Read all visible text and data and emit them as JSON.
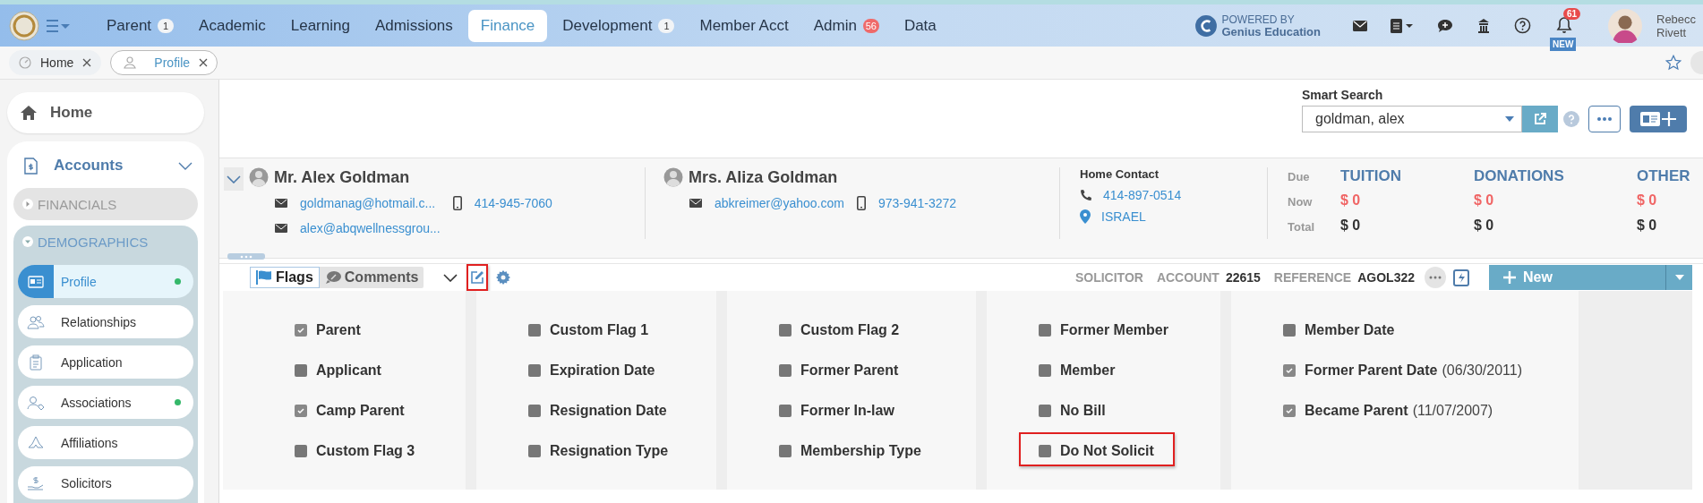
{
  "top_nav": {
    "items": [
      {
        "label": "Parent",
        "badge": "1",
        "badge_alert": false,
        "selected": false
      },
      {
        "label": "Academic",
        "selected": false
      },
      {
        "label": "Learning",
        "selected": false
      },
      {
        "label": "Admissions",
        "selected": false
      },
      {
        "label": "Finance",
        "selected": true
      },
      {
        "label": "Development",
        "badge": "1",
        "badge_alert": false,
        "selected": false
      },
      {
        "label": "Member Acct",
        "selected": false
      },
      {
        "label": "Admin",
        "badge": "56",
        "badge_alert": true,
        "selected": false
      },
      {
        "label": "Data",
        "selected": false
      }
    ],
    "powered_by": [
      "POWERED BY",
      "Genius Education"
    ],
    "notifications": "61",
    "new_tag": "NEW",
    "user": [
      "Rebecc",
      "Rivett"
    ]
  },
  "open_tabs": [
    {
      "label": "Home",
      "selected": false
    },
    {
      "label": "Profile",
      "selected": true
    }
  ],
  "sidebar": {
    "home": "Home",
    "accounts": "Accounts",
    "sections": [
      {
        "label": "FINANCIALS",
        "expanded": false
      },
      {
        "label": "DEMOGRAPHICS",
        "expanded": true,
        "items": [
          {
            "label": "Profile",
            "selected": true,
            "dot": true
          },
          {
            "label": "Relationships",
            "selected": false,
            "dot": false
          },
          {
            "label": "Application",
            "selected": false,
            "dot": false
          },
          {
            "label": "Associations",
            "selected": false,
            "dot": true
          },
          {
            "label": "Affiliations",
            "selected": false,
            "dot": false
          },
          {
            "label": "Solicitors",
            "selected": false,
            "dot": false
          }
        ]
      }
    ]
  },
  "smart_search": {
    "label": "Smart Search",
    "value": "goldman, alex"
  },
  "contacts": [
    {
      "name": "Mr. Alex Goldman",
      "emails": [
        "goldmanag@hotmail.c...",
        "alex@abqwellnessgrou..."
      ],
      "phone": "414-945-7060"
    },
    {
      "name": "Mrs. Aliza Goldman",
      "emails": [
        "abkreimer@yahoo.com"
      ],
      "phone": "973-941-3272"
    }
  ],
  "home_contact": {
    "title": "Home Contact",
    "phone": "414-897-0514",
    "location": "ISRAEL"
  },
  "balances": {
    "row_labels": [
      "Due",
      "Now",
      "Total"
    ],
    "columns": [
      {
        "title": "TUITION",
        "now": "$ 0",
        "total": "$ 0"
      },
      {
        "title": "DONATIONS",
        "now": "$ 0",
        "total": "$ 0"
      },
      {
        "title": "OTHER",
        "now": "$ 0",
        "total": "$ 0"
      }
    ]
  },
  "flags_toolbar": {
    "tabs": [
      {
        "label": "Flags",
        "selected": true
      },
      {
        "label": "Comments",
        "selected": false
      }
    ],
    "edit_highlighted": true,
    "solicitor": "SOLICITOR",
    "account_label": "ACCOUNT",
    "account": "22615",
    "reference_label": "REFERENCE",
    "reference": "AGOL322",
    "new_button": "New"
  },
  "flag_columns": [
    {
      "flags": [
        {
          "label": "Parent",
          "checked": true,
          "highlighted": false
        },
        {
          "label": "Applicant",
          "checked": false,
          "highlighted": false
        },
        {
          "label": "Camp Parent",
          "checked": true,
          "highlighted": false
        },
        {
          "label": "Custom Flag 3",
          "checked": false,
          "highlighted": false
        }
      ]
    },
    {
      "flags": [
        {
          "label": "Custom Flag 1",
          "checked": false,
          "highlighted": false
        },
        {
          "label": "Expiration Date",
          "checked": false,
          "highlighted": false
        },
        {
          "label": "Resignation Date",
          "checked": false,
          "highlighted": false
        },
        {
          "label": "Resignation Type",
          "checked": false,
          "highlighted": false
        }
      ]
    },
    {
      "flags": [
        {
          "label": "Custom Flag 2",
          "checked": false,
          "highlighted": false
        },
        {
          "label": "Former Parent",
          "checked": false,
          "highlighted": false
        },
        {
          "label": "Former In-law",
          "checked": false,
          "highlighted": false
        },
        {
          "label": "Membership Type",
          "checked": false,
          "highlighted": false
        }
      ]
    },
    {
      "flags": [
        {
          "label": "Former Member",
          "checked": false,
          "highlighted": false
        },
        {
          "label": "Member",
          "checked": false,
          "highlighted": false
        },
        {
          "label": "No Bill",
          "checked": false,
          "highlighted": false
        },
        {
          "label": "Do Not Solicit",
          "checked": false,
          "highlighted": true
        }
      ]
    },
    {
      "flags": [
        {
          "label": "Member Date",
          "checked": false,
          "highlighted": false
        },
        {
          "label": "Former Parent Date",
          "date": "(06/30/2011)",
          "checked": true,
          "highlighted": false
        },
        {
          "label": "Became Parent",
          "date": "(11/07/2007)",
          "checked": true,
          "highlighted": false
        }
      ]
    }
  ]
}
